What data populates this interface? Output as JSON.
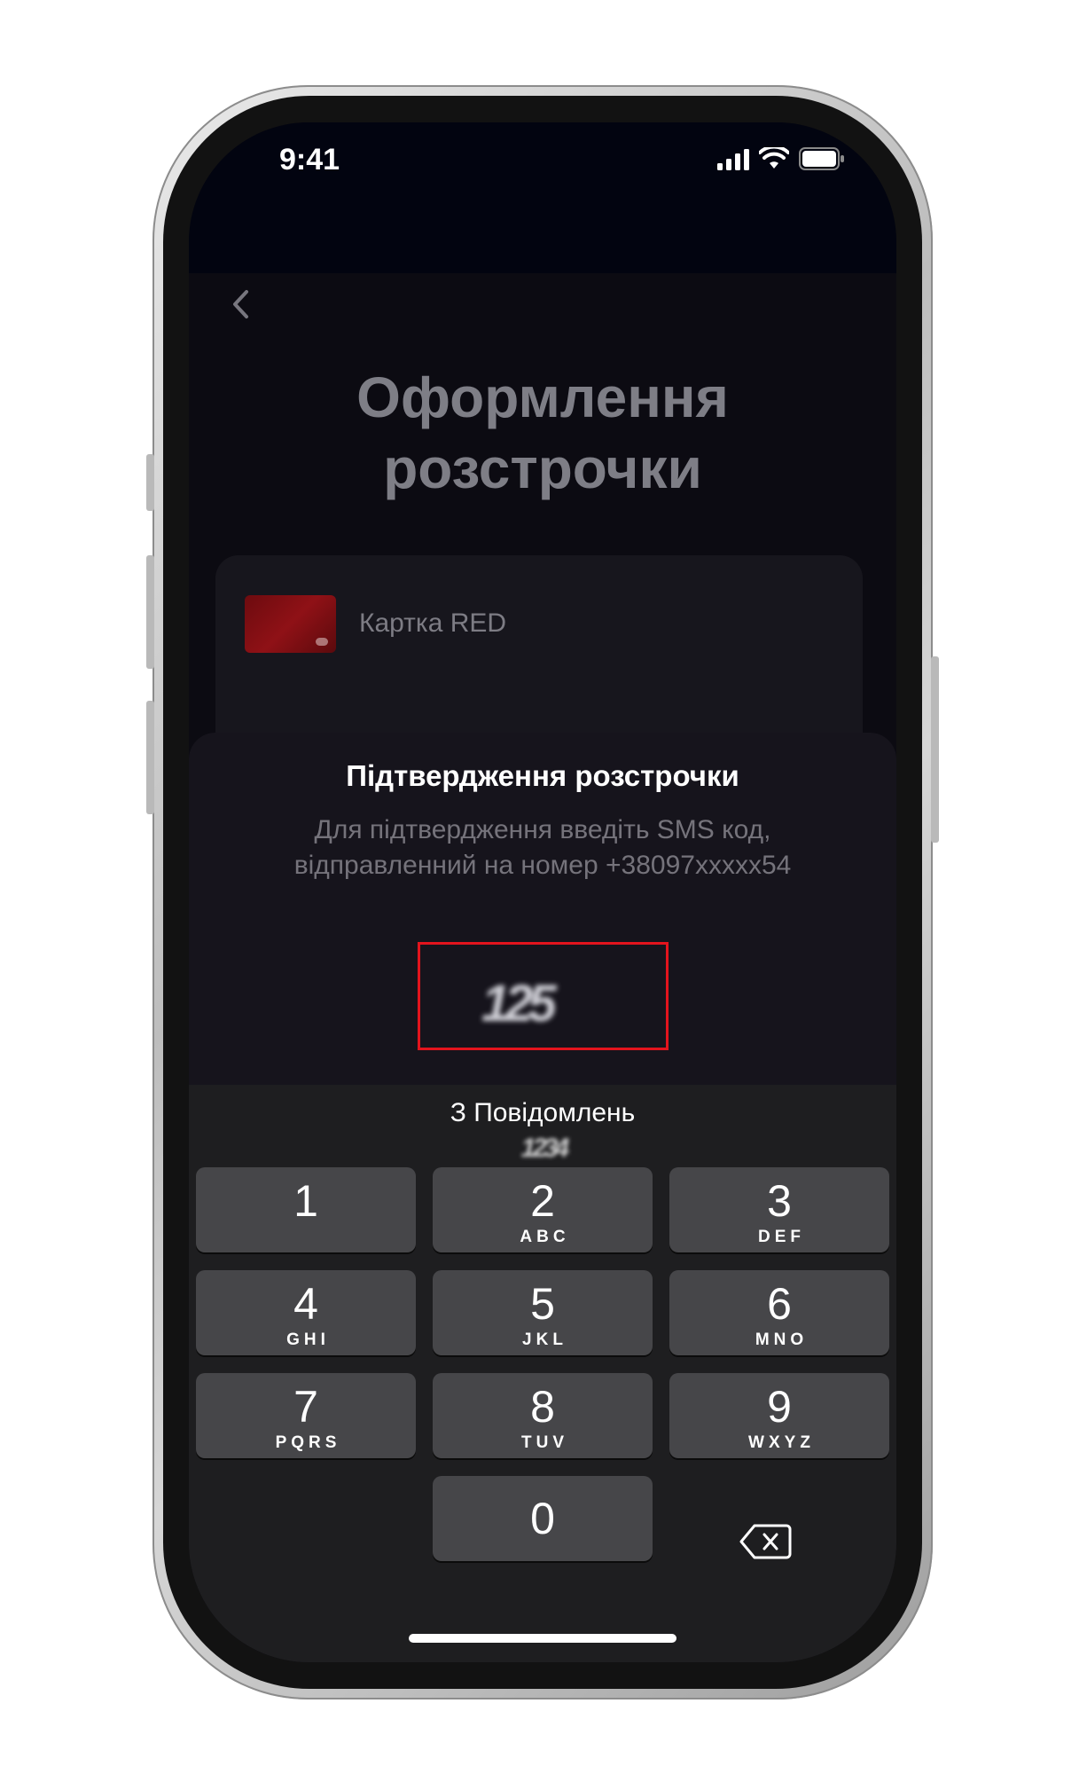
{
  "status_bar": {
    "time": "9:41"
  },
  "page": {
    "title_line1": "Оформлення",
    "title_line2": "розстрочки"
  },
  "card": {
    "name": "Картка RED"
  },
  "sheet": {
    "title": "Підтвердження розстрочки",
    "desc_line1": "Для підтвердження введіть SMS код,",
    "desc_line2": "відправленний на номер +38097xxxxx54",
    "code_blurred": "125"
  },
  "keyboard": {
    "suggestion_label": "З Повідомлень",
    "suggestion_blurred": "1234",
    "keys": [
      {
        "num": "1",
        "letters": ""
      },
      {
        "num": "2",
        "letters": "ABC"
      },
      {
        "num": "3",
        "letters": "DEF"
      },
      {
        "num": "4",
        "letters": "GHI"
      },
      {
        "num": "5",
        "letters": "JKL"
      },
      {
        "num": "6",
        "letters": "MNO"
      },
      {
        "num": "7",
        "letters": "PQRS"
      },
      {
        "num": "8",
        "letters": "TUV"
      },
      {
        "num": "9",
        "letters": "WXYZ"
      },
      {
        "num": "0",
        "letters": ""
      }
    ]
  },
  "colors": {
    "highlight_border": "#e3141d",
    "card_red": "#8f1116",
    "key_bg": "#464649",
    "keyboard_bg": "#1e1e20"
  },
  "icons": {
    "back": "chevron-left-icon",
    "signal": "signal-icon",
    "wifi": "wifi-icon",
    "battery": "battery-icon",
    "delete": "backspace-icon"
  }
}
